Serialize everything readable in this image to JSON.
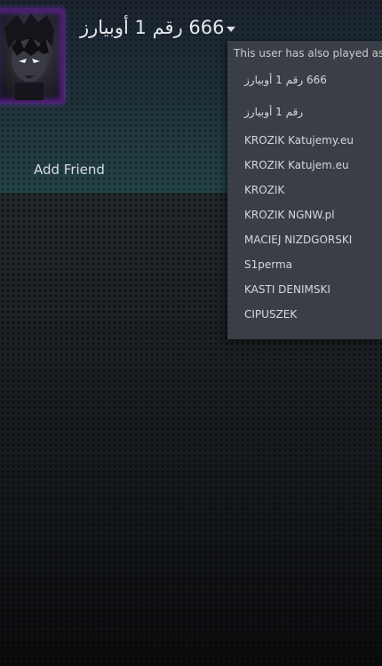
{
  "profile": {
    "persona_name": "666 رقم 1 أوبيارز",
    "avatar_icon": "avatar-image",
    "add_friend_label": "Add Friend"
  },
  "name_history": {
    "header": "This user has also played as:",
    "items": [
      "666 رقم 1 أوبيارز",
      "رقم 1 أوبيارز",
      "KROZIK Katujemy.eu",
      "KROZIK Katujem.eu",
      "KROZIK",
      "KROZIK NGNW.pl",
      "MACIEJ NIZDGORSKI",
      "S1perma",
      "KASTI DENIMSKI",
      "CIPUSZEK"
    ]
  },
  "colors": {
    "accent_border": "#4a1f6d",
    "dropdown_bg": "#3a3f47",
    "text": "#d4d8dc"
  }
}
